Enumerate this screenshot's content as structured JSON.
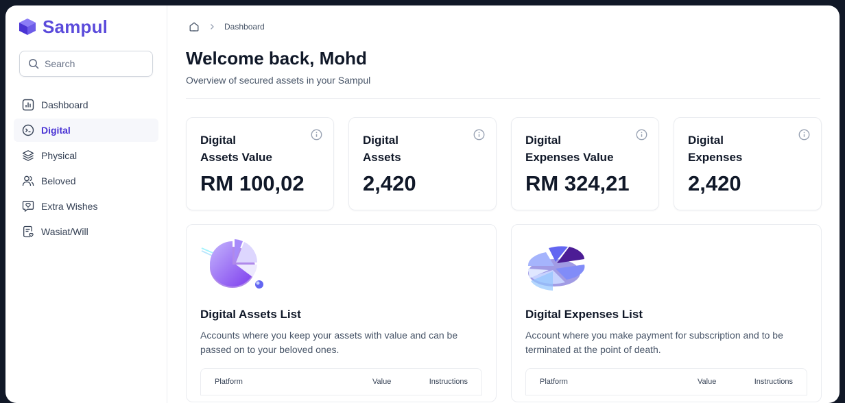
{
  "app": {
    "name": "Sampul"
  },
  "search": {
    "placeholder": "Search"
  },
  "sidebar": {
    "items": [
      {
        "label": "Dashboard",
        "icon": "bar-chart-icon",
        "active": false
      },
      {
        "label": "Digital",
        "icon": "terminal-icon",
        "active": true
      },
      {
        "label": "Physical",
        "icon": "layers-icon",
        "active": false
      },
      {
        "label": "Beloved",
        "icon": "users-icon",
        "active": false
      },
      {
        "label": "Extra Wishes",
        "icon": "message-heart-icon",
        "active": false
      },
      {
        "label": "Wasiat/Will",
        "icon": "file-heart-icon",
        "active": false
      }
    ]
  },
  "breadcrumb": {
    "current": "Dashboard"
  },
  "header": {
    "title": "Welcome back, Mohd",
    "subtitle": "Overview of secured assets in your Sampul"
  },
  "stats": [
    {
      "label_line1": "Digital",
      "label_line2": "Assets Value",
      "value": "RM 100,02"
    },
    {
      "label_line1": "Digital",
      "label_line2": "Assets",
      "value": "2,420"
    },
    {
      "label_line1": "Digital",
      "label_line2": "Expenses Value",
      "value": "RM 324,21"
    },
    {
      "label_line1": "Digital",
      "label_line2": "Expenses",
      "value": "2,420"
    }
  ],
  "lists": [
    {
      "title": "Digital Assets List",
      "description": "Accounts where you keep your assets with value and can be passed on to your beloved ones.",
      "columns": {
        "platform": "Platform",
        "value": "Value",
        "instructions": "Instructions"
      }
    },
    {
      "title": "Digital Expenses List",
      "description": "Account where you make payment for subscription and to be terminated at the point of death.",
      "columns": {
        "platform": "Platform",
        "value": "Value",
        "instructions": "Instructions"
      }
    }
  ],
  "colors": {
    "brand": "#5b4bdb",
    "active_text": "#4a34d4",
    "active_bg": "#f6f7fb",
    "frame_bg": "#111827"
  }
}
